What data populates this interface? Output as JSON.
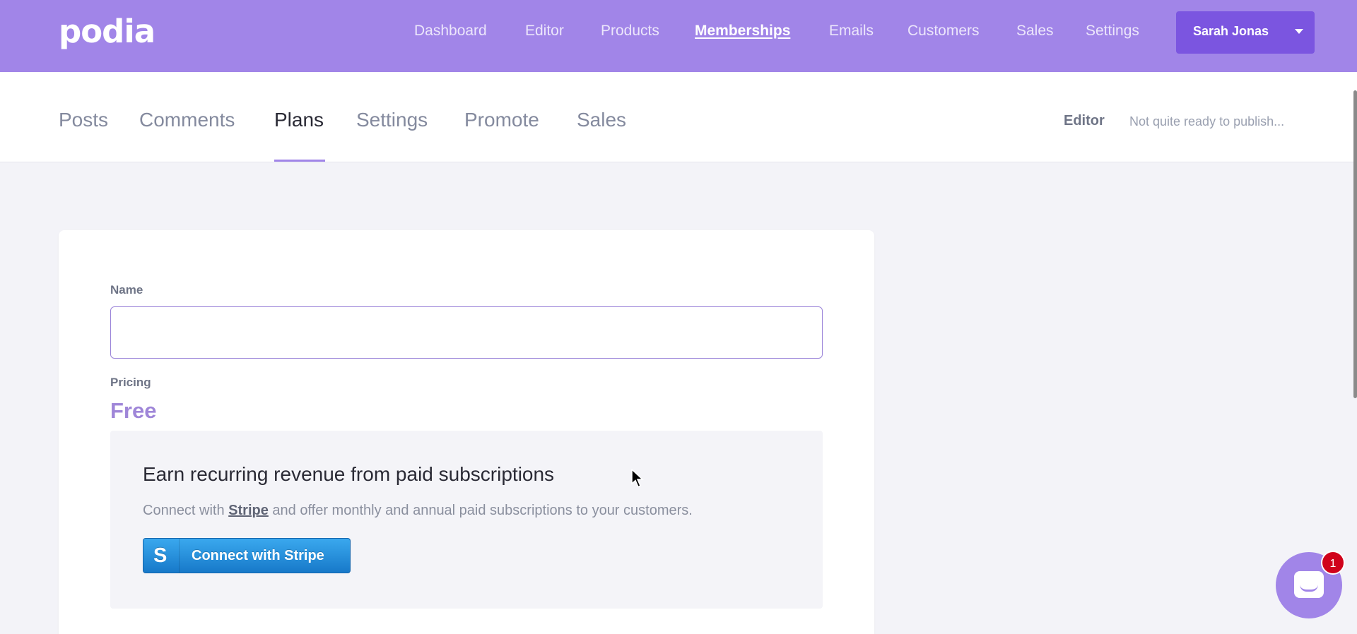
{
  "brand": {
    "logo_text": "podia",
    "accent_color": "#a185e8",
    "button_color": "#7b55e0"
  },
  "top_nav": {
    "items": [
      {
        "label": "Dashboard",
        "active": false
      },
      {
        "label": "Editor",
        "active": false
      },
      {
        "label": "Products",
        "active": false
      },
      {
        "label": "Memberships",
        "active": true
      },
      {
        "label": "Emails",
        "active": false
      },
      {
        "label": "Customers",
        "active": false
      },
      {
        "label": "Sales",
        "active": false
      },
      {
        "label": "Settings",
        "active": false
      }
    ],
    "user_name": "Sarah Jonas",
    "user_menu_icon": "caret-down-icon"
  },
  "sub_nav": {
    "tabs": [
      {
        "label": "Posts",
        "active": false
      },
      {
        "label": "Comments",
        "active": false
      },
      {
        "label": "Plans",
        "active": true
      },
      {
        "label": "Settings",
        "active": false
      },
      {
        "label": "Promote",
        "active": false
      },
      {
        "label": "Sales",
        "active": false
      }
    ],
    "editor_label": "Editor",
    "status_text": "Not quite ready to publish..."
  },
  "plan_form": {
    "name_label": "Name",
    "name_value": "",
    "name_placeholder": "",
    "pricing_label": "Pricing",
    "price_value": "Free"
  },
  "stripe_promo": {
    "title": "Earn recurring revenue from paid subscriptions",
    "desc_before": "Connect with ",
    "desc_link": "Stripe",
    "desc_after": " and offer monthly and annual paid subscriptions to your customers.",
    "button_icon_glyph": "S",
    "button_label": "Connect with Stripe"
  },
  "chat": {
    "badge_count": "1",
    "icon": "chat-bubble-icon"
  }
}
